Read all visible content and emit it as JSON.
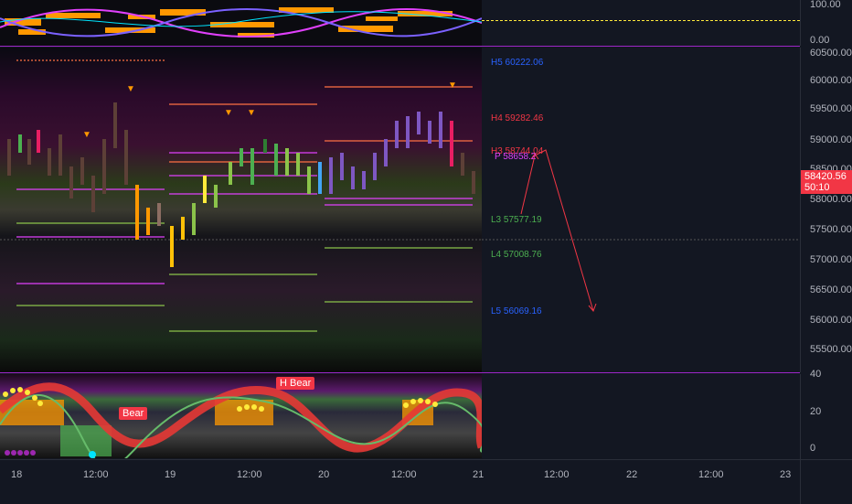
{
  "top_scale": {
    "ticks": [
      "100.00",
      "0.00"
    ]
  },
  "price_scale": {
    "ticks": [
      "60500.00",
      "60000.00",
      "59500.00",
      "59000.00",
      "58500.00",
      "58000.00",
      "57500.00",
      "57000.00",
      "56500.00",
      "56000.00",
      "55500.00"
    ]
  },
  "bottom_scale": {
    "ticks": [
      "40",
      "20",
      "0"
    ]
  },
  "current_price": {
    "value": "58420.56",
    "countdown": "50:10",
    "color": "#f23645"
  },
  "levels": [
    {
      "label": "H5 60222.06",
      "color": "#2962ff"
    },
    {
      "label": "H4 59282.46",
      "color": "#f23645"
    },
    {
      "label": "H3 58744.04",
      "color": "#f23645"
    },
    {
      "label": "P 58658.2",
      "color": "#e040fb"
    },
    {
      "label": "L3 57577.19",
      "color": "#4caf50"
    },
    {
      "label": "L4 57008.76",
      "color": "#4caf50"
    },
    {
      "label": "L5 56069.16",
      "color": "#2962ff"
    }
  ],
  "time_axis": [
    "18",
    "12:00",
    "19",
    "12:00",
    "20",
    "12:00",
    "21",
    "12:00",
    "22",
    "12:00",
    "23"
  ],
  "labels": {
    "h_bear": "H Bear",
    "bear": "Bear"
  },
  "colors": {
    "accent": "#9d26c8",
    "up": "#4caf50",
    "down": "#f23645"
  }
}
